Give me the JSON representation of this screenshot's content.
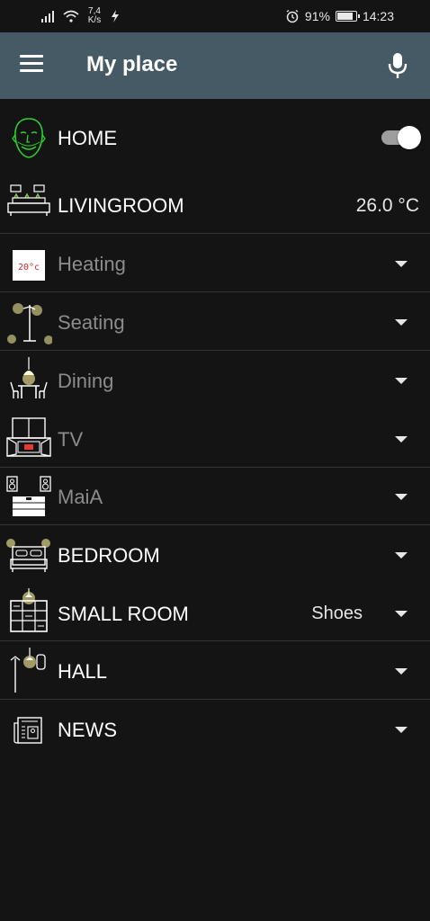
{
  "status_bar": {
    "net_speed_value": "7,4",
    "net_speed_unit": "K/s",
    "battery_percent": "91%",
    "battery_level": 0.91,
    "time": "14:23"
  },
  "app_bar": {
    "title": "My place"
  },
  "rows": [
    {
      "label": "HOME",
      "icon": "face-icon",
      "control": "toggle",
      "toggle_on": true
    },
    {
      "label": "LIVINGROOM",
      "icon": "livingroom-icon",
      "value": "26.0 °C"
    },
    {
      "label": "Heating",
      "icon": "thermostat-icon",
      "thermostat_text": "20°c",
      "dim": true
    },
    {
      "label": "Seating",
      "icon": "floor-lamp-icon",
      "dim": true
    },
    {
      "label": "Dining",
      "icon": "dining-icon",
      "dim": true
    },
    {
      "label": "TV",
      "icon": "tv-cabinet-icon",
      "dim": true
    },
    {
      "label": "MaiA",
      "icon": "speakers-icon",
      "dim": true
    },
    {
      "label": "BEDROOM",
      "icon": "bed-icon"
    },
    {
      "label": "SMALL ROOM",
      "icon": "shelf-icon",
      "value": "Shoes"
    },
    {
      "label": "HALL",
      "icon": "hall-icon"
    },
    {
      "label": "NEWS",
      "icon": "newspaper-icon"
    }
  ],
  "colors": {
    "background": "#141414",
    "app_bar": "#455a64",
    "dim_text": "#8c8c8c",
    "lamp_glow": "#ffee7a",
    "face_outline": "#2bd12b"
  }
}
